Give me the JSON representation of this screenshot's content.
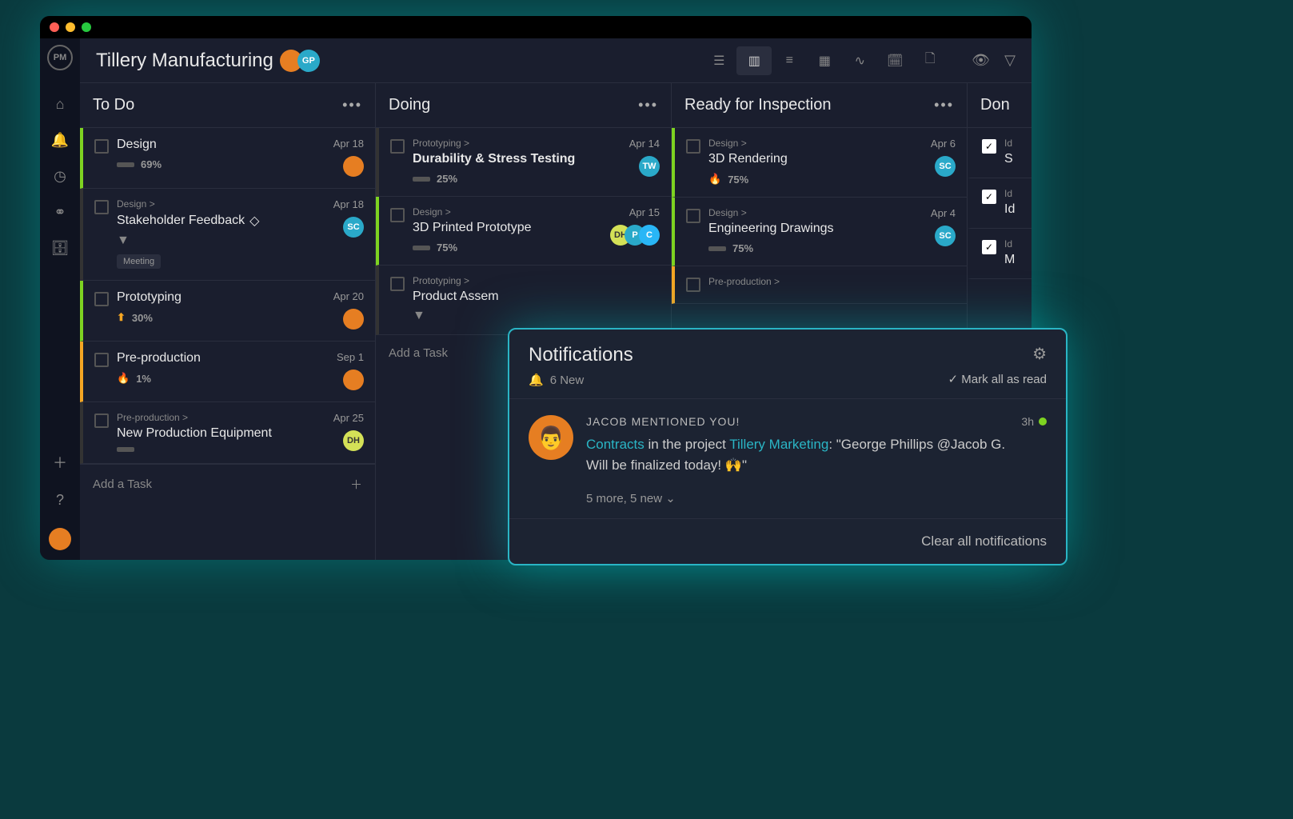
{
  "app": {
    "logo": "PM",
    "title": "Tillery Manufacturing",
    "header_avatars": [
      "",
      "GP"
    ]
  },
  "sidebar": {
    "icons": [
      "home",
      "bell",
      "clock",
      "users",
      "briefcase",
      "plus",
      "help"
    ]
  },
  "view_icons": [
    "list",
    "board",
    "gantt",
    "sheet",
    "activity",
    "calendar",
    "file"
  ],
  "columns": [
    {
      "title": "To Do",
      "add_task": "Add a Task",
      "cards": [
        {
          "bar": "green",
          "title": "Design",
          "progress": "69%",
          "date": "Apr 18",
          "avatars": [
            {
              "cls": "av-orange",
              "txt": ""
            }
          ]
        },
        {
          "bar": "dark",
          "breadcrumb": "Design >",
          "title": "Stakeholder Feedback",
          "diamond": true,
          "chevron": true,
          "tag": "Meeting",
          "date": "Apr 18",
          "avatars": [
            {
              "cls": "av-teal",
              "txt": "SC"
            }
          ]
        },
        {
          "bar": "green",
          "title": "Prototyping",
          "progress": "30%",
          "icon": "arrow-up",
          "date": "Apr 20",
          "avatars": [
            {
              "cls": "av-orange",
              "txt": ""
            }
          ]
        },
        {
          "bar": "orange",
          "title": "Pre-production",
          "progress": "1%",
          "icon": "flame",
          "date": "Sep 1",
          "avatars": [
            {
              "cls": "av-orange",
              "txt": ""
            }
          ]
        },
        {
          "bar": "dark",
          "breadcrumb": "Pre-production >",
          "title": "New Production Equipment",
          "progress": "",
          "date": "Apr 25",
          "avatars": [
            {
              "cls": "av-yellow",
              "txt": "DH"
            }
          ]
        }
      ]
    },
    {
      "title": "Doing",
      "add_task": "Add a Task",
      "cards": [
        {
          "bar": "dark",
          "breadcrumb": "Prototyping >",
          "title": "Durability & Stress Testing",
          "bold": true,
          "progress": "25%",
          "date": "Apr 14",
          "avatars": [
            {
              "cls": "av-teal",
              "txt": "TW"
            }
          ]
        },
        {
          "bar": "green",
          "breadcrumb": "Design >",
          "title": "3D Printed Prototype",
          "progress": "75%",
          "date": "Apr 15",
          "avatars": [
            {
              "cls": "av-yellow",
              "txt": "DH"
            },
            {
              "cls": "av-teal",
              "txt": "P"
            },
            {
              "cls": "av-blue",
              "txt": "C"
            }
          ]
        },
        {
          "bar": "dark",
          "breadcrumb": "Prototyping >",
          "title": "Product Assem",
          "chevron": true
        }
      ]
    },
    {
      "title": "Ready for Inspection",
      "cards": [
        {
          "bar": "green",
          "breadcrumb": "Design >",
          "title": "3D Rendering",
          "progress": "75%",
          "icon": "flame",
          "date": "Apr 6",
          "avatars": [
            {
              "cls": "av-teal",
              "txt": "SC"
            }
          ]
        },
        {
          "bar": "green",
          "breadcrumb": "Design >",
          "title": "Engineering Drawings",
          "progress": "75%",
          "date": "Apr 4",
          "avatars": [
            {
              "cls": "av-teal",
              "txt": "SC"
            }
          ]
        },
        {
          "bar": "orange",
          "breadcrumb": "Pre-production >"
        }
      ]
    },
    {
      "title": "Don",
      "cards": [
        {
          "checked": true,
          "breadcrumb": "Id",
          "title": "S"
        },
        {
          "checked": true,
          "breadcrumb": "Id",
          "title": "Id"
        },
        {
          "checked": true,
          "breadcrumb": "Id",
          "title": "M"
        }
      ]
    }
  ],
  "notifications": {
    "title": "Notifications",
    "count_label": "6 New",
    "mark_all": "Mark all as read",
    "item": {
      "heading": "JACOB MENTIONED YOU!",
      "link1": "Contracts",
      "mid1": " in the project ",
      "link2": "Tillery Marketing",
      "mid2": ": \"George Phillips @Jacob G. Will be finalized today! 🙌\"",
      "time": "3h"
    },
    "more": "5 more, 5 new",
    "clear": "Clear all notifications"
  }
}
